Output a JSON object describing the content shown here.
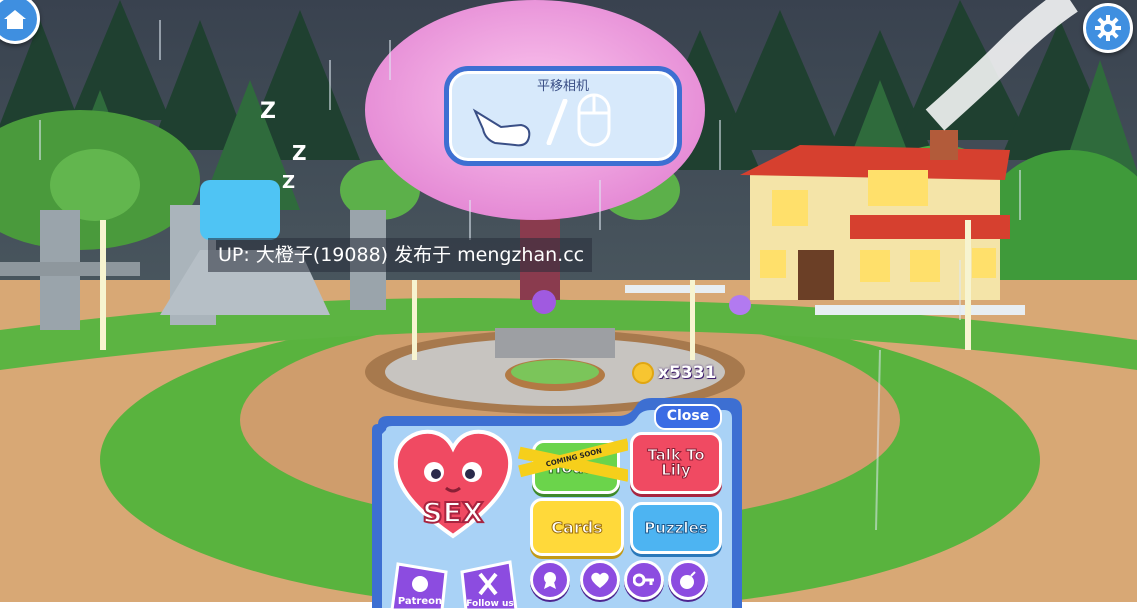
{
  "hud": {
    "home_icon": "home-icon",
    "settings_icon": "gear-icon",
    "accent": "#3f8fe0"
  },
  "camera_hint": {
    "title": "平移相机",
    "hand_icon": "pointing-hand-icon",
    "mouse_icon": "mouse-icon"
  },
  "watermark": {
    "text": "UP: 大橙子(19088) 发布于 mengzhan.cc"
  },
  "currency": {
    "icon": "coin-icon",
    "amount": "x5331"
  },
  "menu": {
    "close_label": "Close",
    "sex_label": "SEX",
    "house_label": "House",
    "house_tape_text": "COMING SOON",
    "talk_label": "Talk To Lily",
    "cards_label": "Cards",
    "puzzles_label": "Puzzles",
    "patreon_label": "Patreon",
    "follow_label": "Follow us",
    "round_buttons": [
      "award-icon",
      "heart-icon",
      "key-icon",
      "bomb-icon"
    ],
    "colors": {
      "frame": "#3d6fd2",
      "panel": "#a9d2f6",
      "sex": "#f04a62",
      "house": "#6bd44b",
      "cards": "#ffd93a",
      "puzzles": "#4db4f2",
      "round": "#8c4ce0"
    }
  }
}
